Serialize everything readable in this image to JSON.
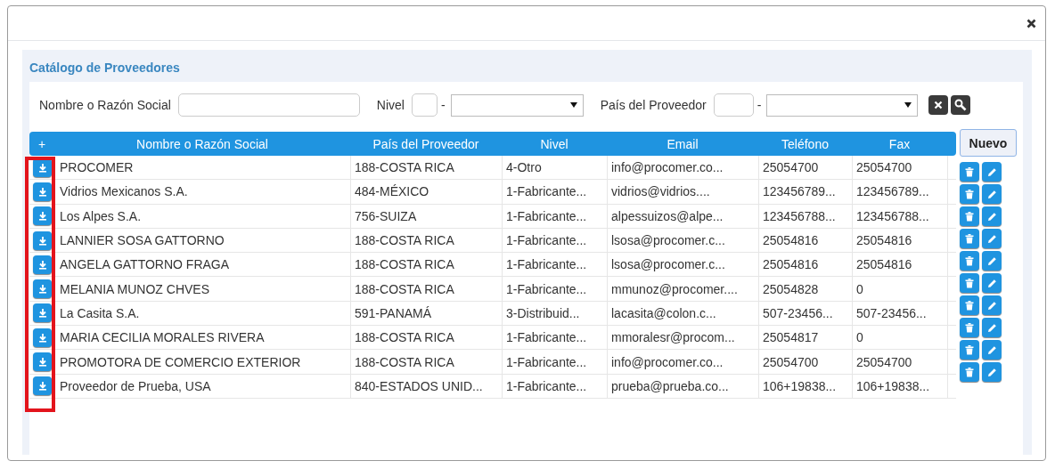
{
  "panel": {
    "title": "Catálogo de Proveedores"
  },
  "filters": {
    "name_label": "Nombre o Razón Social",
    "level_label": "Nivel",
    "level_separator": "-",
    "country_label": "País del Proveedor",
    "country_separator": "-"
  },
  "table": {
    "expand_header": "+",
    "columns": [
      "Nombre o Razón Social",
      "País del Proveedor",
      "Nivel",
      "Email",
      "Teléfono",
      "Fax"
    ],
    "rows": [
      {
        "cells": [
          "PROCOMER",
          "188-COSTA RICA",
          "4-Otro",
          "info@procomer.co...",
          "25054700",
          "25054700"
        ]
      },
      {
        "cells": [
          "Vidrios Mexicanos S.A.",
          "484-MÉXICO",
          "1-Fabricante...",
          "vidrios@vidrios....",
          "123456789...",
          "123456789..."
        ]
      },
      {
        "cells": [
          "Los Alpes S.A.",
          "756-SUIZA",
          "1-Fabricante...",
          "alpessuizos@alpe...",
          "123456788...",
          "123456788..."
        ]
      },
      {
        "cells": [
          "LANNIER SOSA GATTORNO",
          "188-COSTA RICA",
          "1-Fabricante...",
          "lsosa@procomer.c...",
          "25054816",
          "25054816"
        ]
      },
      {
        "cells": [
          "ANGELA GATTORNO FRAGA",
          "188-COSTA RICA",
          "1-Fabricante...",
          "lsosa@procomer.c...",
          "25054816",
          "25054816"
        ]
      },
      {
        "cells": [
          "MELANIA MUNOZ CHVES",
          "188-COSTA RICA",
          "1-Fabricante...",
          "mmunoz@procomer....",
          "25054828",
          "0"
        ]
      },
      {
        "cells": [
          "La Casita S.A.",
          "591-PANAMÁ",
          "3-Distribuid...",
          "lacasita@colon.c...",
          "507-23456...",
          "507-23456..."
        ]
      },
      {
        "cells": [
          "MARIA CECILIA MORALES RIVERA",
          "188-COSTA RICA",
          "1-Fabricante...",
          "mmoralesr@procom...",
          "25054817",
          "0"
        ]
      },
      {
        "cells": [
          "PROMOTORA DE COMERCIO EXTERIOR",
          "188-COSTA RICA",
          "1-Fabricante...",
          "info@procomer.co...",
          "25054700",
          "25054700"
        ]
      },
      {
        "cells": [
          "Proveedor de Prueba, USA",
          "840-ESTADOS UNID...",
          "1-Fabricante...",
          "prueba@prueba.co...",
          "106+19838...",
          "106+19838..."
        ]
      }
    ]
  },
  "new_button": "Nuevo"
}
